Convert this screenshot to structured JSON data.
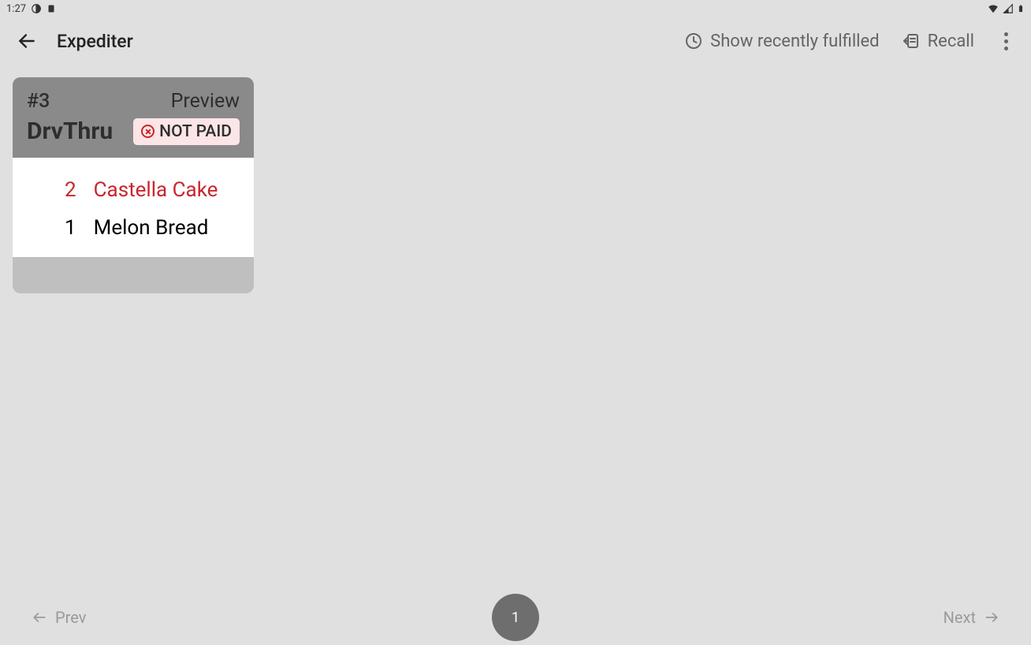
{
  "status_bar": {
    "time": "1:27"
  },
  "app_bar": {
    "title": "Expediter",
    "actions": {
      "show_recently_fulfilled": "Show recently fulfilled",
      "recall": "Recall"
    }
  },
  "order_card": {
    "order_number": "#3",
    "preview_label": "Preview",
    "source": "DrvThru",
    "not_paid_label": "NOT PAID",
    "items": [
      {
        "qty": "2",
        "name": "Castella Cake",
        "highlight": true
      },
      {
        "qty": "1",
        "name": "Melon Bread",
        "highlight": false
      }
    ]
  },
  "pagination": {
    "prev": "Prev",
    "next": "Next",
    "page": "1"
  }
}
